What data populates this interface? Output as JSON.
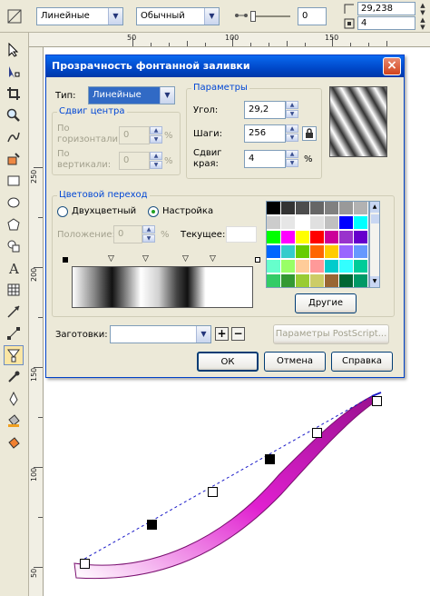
{
  "propbar": {
    "gradient_type": "Линейные",
    "merge_mode": "Обычный",
    "midpoint_value": "0",
    "angle_value": "29,238",
    "edge_value": "4"
  },
  "ruler": {
    "h_labels": [
      "50",
      "100",
      "150"
    ],
    "v_labels": [
      "250",
      "200",
      "150",
      "100",
      "50"
    ]
  },
  "tools": [
    "pointer-icon",
    "shape-icon",
    "crop-icon",
    "zoom-icon",
    "freehand-icon",
    "smart-fill-icon",
    "rectangle-icon",
    "ellipse-icon",
    "polygon-icon",
    "basic-shapes-icon",
    "text-icon",
    "table-icon",
    "dimension-icon",
    "connector-icon",
    "transparency-icon",
    "eyedropper-icon",
    "outline-pen-icon",
    "fill-icon",
    "interactive-fill-icon"
  ],
  "dialog": {
    "title": "Прозрачность фонтанной заливки",
    "type_label": "Тип:",
    "type_value": "Линейные",
    "center_group": "Сдвиг центра",
    "horizontal_label": "По горизонтали:",
    "horizontal_value": "0",
    "vertical_label": "По вертикали:",
    "vertical_value": "0",
    "percent": "%",
    "params_group": "Параметры",
    "angle_label": "Угол:",
    "angle_value": "29,2",
    "steps_label": "Шаги:",
    "steps_value": "256",
    "edge_label": "Сдвиг края:",
    "edge_value": "4",
    "blend_group": "Цветовой переход",
    "two_color_label": "Двухцветный",
    "custom_label": "Настройка",
    "position_label": "Положение:",
    "position_value": "0",
    "current_label": "Текущее:",
    "others_button": "Другие",
    "presets_label": "Заготовки:",
    "presets_value": "",
    "postscript_button": "Параметры PostScript...",
    "ok_button": "ОК",
    "cancel_button": "Отмена",
    "help_button": "Справка"
  },
  "palette": [
    "#000000",
    "#333333",
    "#4d4d4d",
    "#666666",
    "#808080",
    "#999999",
    "#b2b2b2",
    "#cccccc",
    "#e6e6e6",
    "#ffffff",
    "#e0e0e0",
    "#c0c0c0",
    "#0000ff",
    "#00ffff",
    "#00ff00",
    "#ff00ff",
    "#ffff00",
    "#ff0000",
    "#cc0099",
    "#9933cc",
    "#6600cc",
    "#0066ff",
    "#33cccc",
    "#66cc00",
    "#ff6600",
    "#ffcc00",
    "#9966ff",
    "#6699ff",
    "#66ffcc",
    "#99ff66",
    "#ffcc99",
    "#ff9999",
    "#00cccc",
    "#33ffff",
    "#00cc99",
    "#33cc66",
    "#339933",
    "#99cc33",
    "#cccc66",
    "#996633",
    "#006633",
    "#009966",
    "#00cc66",
    "#33cc33",
    "#66cc33",
    "#669900",
    "#999933",
    "#996600"
  ],
  "colors": {
    "curve": "#e020d0",
    "title_bar": "#0047c8",
    "accent": "#0046d5"
  }
}
